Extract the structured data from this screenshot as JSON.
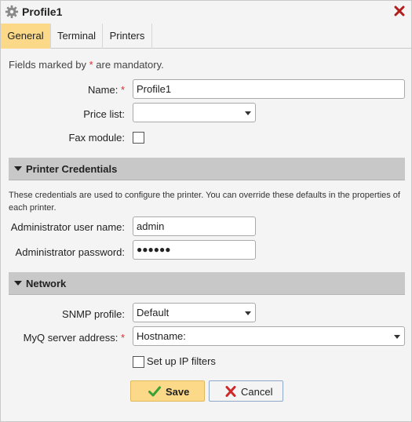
{
  "dialog": {
    "title": "Profile1",
    "icons": {
      "title": "gear-icon",
      "close": "close-icon"
    }
  },
  "tabs": [
    {
      "label": "General",
      "active": true
    },
    {
      "label": "Terminal",
      "active": false
    },
    {
      "label": "Printers",
      "active": false
    }
  ],
  "general": {
    "mandatory_note_prefix": "Fields marked by ",
    "mandatory_note_star": "*",
    "mandatory_note_suffix": " are mandatory.",
    "name": {
      "label": "Name:",
      "required_mark": "*",
      "value": "Profile1"
    },
    "price_list": {
      "label": "Price list:",
      "value": ""
    },
    "fax_module": {
      "label": "Fax module:",
      "checked": false
    }
  },
  "printer_credentials": {
    "title": "Printer Credentials",
    "description": "These credentials are used to configure the printer. You can override these defaults in the properties of each printer.",
    "admin_user": {
      "label": "Administrator user name:",
      "value": "admin"
    },
    "admin_password": {
      "label": "Administrator password:",
      "masked_value": "●●●●●●"
    }
  },
  "network": {
    "title": "Network",
    "snmp_profile": {
      "label": "SNMP profile:",
      "value": "Default"
    },
    "myq_server": {
      "label": "MyQ server address:",
      "required_mark": "*",
      "value": "Hostname:"
    },
    "ip_filters": {
      "label": "Set up IP filters",
      "checked": false
    }
  },
  "buttons": {
    "save": "Save",
    "cancel": "Cancel"
  },
  "colors": {
    "accent": "#fbd988",
    "required": "#d32f2f",
    "save_check": "#3aa136",
    "cancel_x": "#cc2a2a",
    "close_x": "#b01e1e"
  }
}
